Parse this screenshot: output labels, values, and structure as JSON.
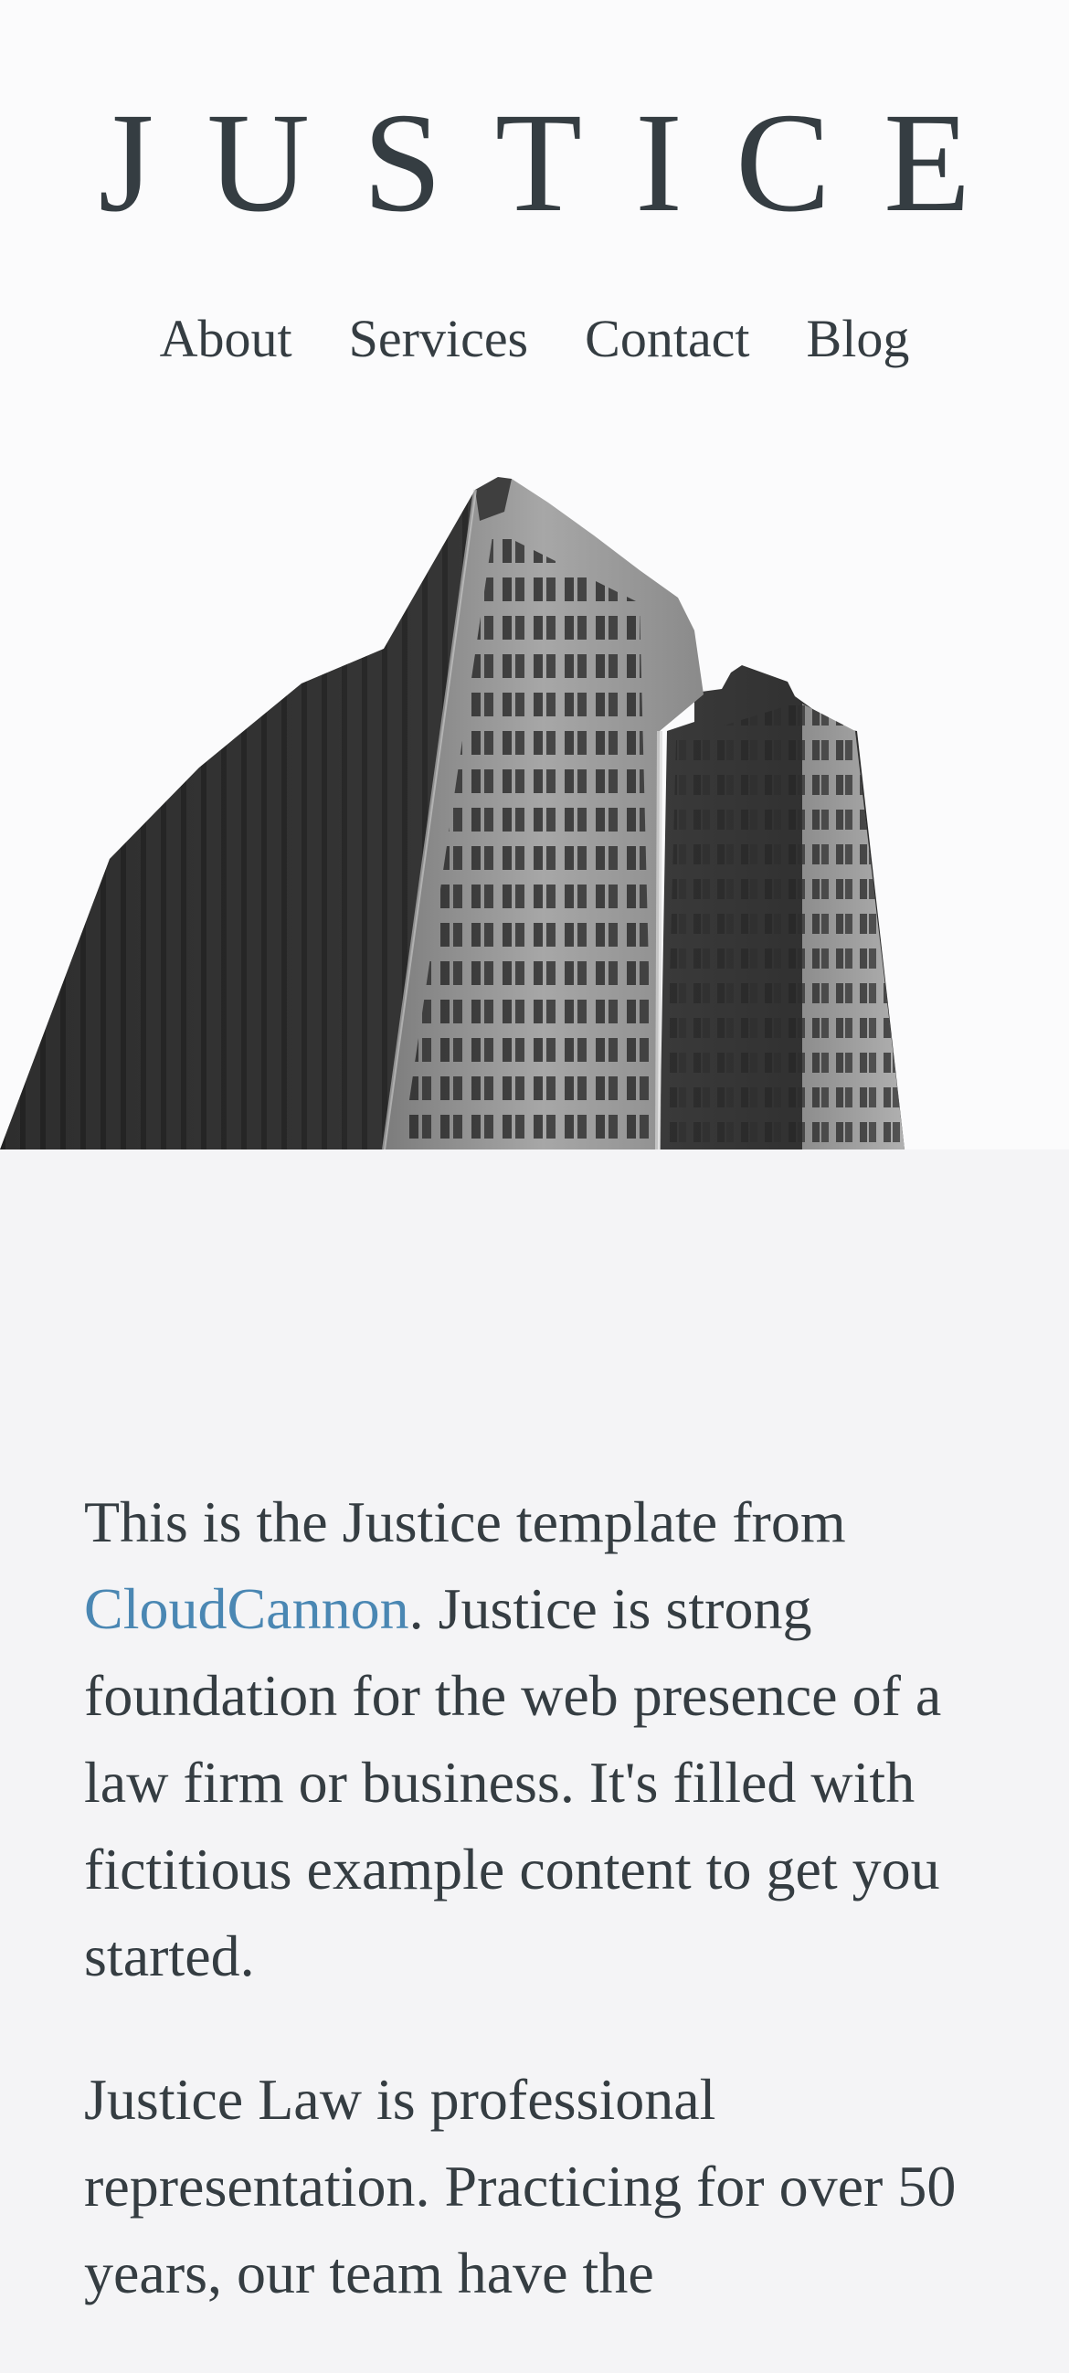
{
  "site": {
    "logo": "JUSTICE"
  },
  "nav": {
    "items": [
      {
        "label": "About"
      },
      {
        "label": "Services"
      },
      {
        "label": "Contact"
      },
      {
        "label": "Blog"
      }
    ]
  },
  "hero": {
    "image_icon": "building-photo"
  },
  "intro": {
    "p1_before": "This is the Justice template from ",
    "p1_link": "CloudCannon",
    "p1_after": ". Justice is strong foundation for the web presence of a law firm or business. It's filled with fictitious example content to get you started.",
    "p2": "Justice Law is professional representation. Practicing for over 50 years, our team have the"
  },
  "colors": {
    "text": "#353d42",
    "link": "#4a87b3",
    "header_bg": "#fbfbfc",
    "body_bg": "#f4f4f6"
  }
}
